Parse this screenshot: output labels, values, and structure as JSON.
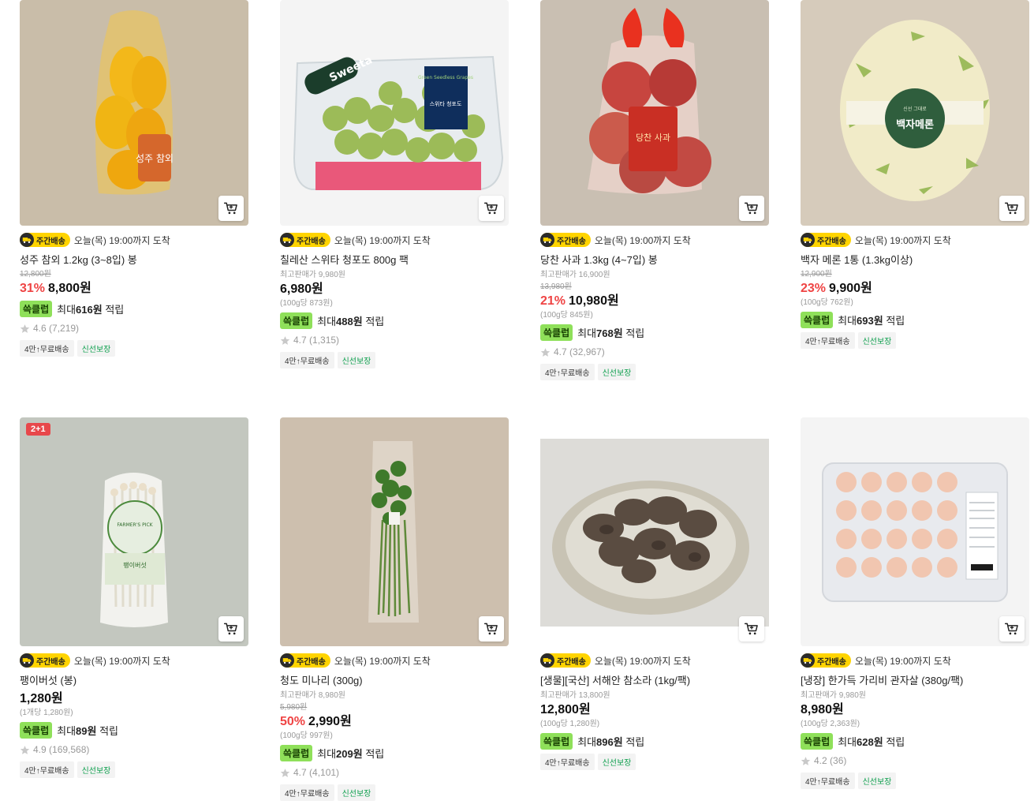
{
  "products": [
    {
      "delivery_badge": "주간배송",
      "delivery_text": "오늘(목) 19:00까지 도착",
      "name": "성주 참외 1.2kg (3~8입) 봉",
      "original_price": "12,800원",
      "discount": "31%",
      "price": "8,800원",
      "points_badge": "쓱클럽",
      "points_prefix": "최대",
      "points_amount": "616원",
      "points_suffix": "적립",
      "rating": "4.6",
      "reviews": "(7,219)",
      "tags": [
        "4만↑무료배송",
        "신선보장"
      ]
    },
    {
      "delivery_badge": "주간배송",
      "delivery_text": "오늘(목) 19:00까지 도착",
      "name": "칠레산 스위타 청포도 800g 팩",
      "highest_price": "최고판매가 9,980원",
      "price": "6,980원",
      "unit_price": "(100g당 873원)",
      "points_badge": "쓱클럽",
      "points_prefix": "최대",
      "points_amount": "488원",
      "points_suffix": "적립",
      "rating": "4.7",
      "reviews": "(1,315)",
      "tags": [
        "4만↑무료배송",
        "신선보장"
      ]
    },
    {
      "delivery_badge": "주간배송",
      "delivery_text": "오늘(목) 19:00까지 도착",
      "name": "당찬 사과 1.3kg (4~7입) 봉",
      "highest_price": "최고판매가 16,900원",
      "original_price": "13,980원",
      "discount": "21%",
      "price": "10,980원",
      "unit_price": "(100g당 845원)",
      "points_badge": "쓱클럽",
      "points_prefix": "최대",
      "points_amount": "768원",
      "points_suffix": "적립",
      "rating": "4.7",
      "reviews": "(32,967)",
      "tags": [
        "4만↑무료배송",
        "신선보장"
      ]
    },
    {
      "delivery_badge": "주간배송",
      "delivery_text": "오늘(목) 19:00까지 도착",
      "name": "백자 메론 1통 (1.3kg이상)",
      "original_price": "12,900원",
      "discount": "23%",
      "price": "9,900원",
      "unit_price": "(100g당 762원)",
      "points_badge": "쓱클럽",
      "points_prefix": "최대",
      "points_amount": "693원",
      "points_suffix": "적립",
      "tags": [
        "4만↑무료배송",
        "신선보장"
      ]
    },
    {
      "promo": "2+1",
      "delivery_badge": "주간배송",
      "delivery_text": "오늘(목) 19:00까지 도착",
      "name": "팽이버섯 (봉)",
      "price": "1,280원",
      "unit_price": "(1개당 1,280원)",
      "points_badge": "쓱클럽",
      "points_prefix": "최대",
      "points_amount": "89원",
      "points_suffix": "적립",
      "rating": "4.9",
      "reviews": "(169,568)",
      "tags": [
        "4만↑무료배송",
        "신선보장"
      ]
    },
    {
      "delivery_badge": "주간배송",
      "delivery_text": "오늘(목) 19:00까지 도착",
      "name": "청도 미나리 (300g)",
      "highest_price": "최고판매가 8,980원",
      "original_price": "5,980원",
      "discount": "50%",
      "price": "2,990원",
      "unit_price": "(100g당 997원)",
      "points_badge": "쓱클럽",
      "points_prefix": "최대",
      "points_amount": "209원",
      "points_suffix": "적립",
      "rating": "4.7",
      "reviews": "(4,101)",
      "tags": [
        "4만↑무료배송",
        "신선보장"
      ]
    },
    {
      "delivery_badge": "주간배송",
      "delivery_text": "오늘(목) 19:00까지 도착",
      "name": "[생물][국산] 서해안 참소라 (1kg/팩)",
      "highest_price": "최고판매가 13,800원",
      "price": "12,800원",
      "unit_price": "(100g당 1,280원)",
      "points_badge": "쓱클럽",
      "points_prefix": "최대",
      "points_amount": "896원",
      "points_suffix": "적립",
      "tags": [
        "4만↑무료배송",
        "신선보장"
      ]
    },
    {
      "delivery_badge": "주간배송",
      "delivery_text": "오늘(목) 19:00까지 도착",
      "name": "[냉장] 한가득 가리비 관자살 (380g/팩)",
      "highest_price": "최고판매가 9,980원",
      "price": "8,980원",
      "unit_price": "(100g당 2,363원)",
      "points_badge": "쓱클럽",
      "points_prefix": "최대",
      "points_amount": "628원",
      "points_suffix": "적립",
      "rating": "4.2",
      "reviews": "(36)",
      "tags": [
        "4만↑무료배송",
        "신선보장"
      ]
    }
  ],
  "image_labels": {
    "melon_bag_label": "성주 참외",
    "grape_brand": "Sweeta",
    "grape_tag": "Green Seedless Grapes",
    "grape_tag_kr": "스위타 청포도",
    "apple_label": "당찬 사과",
    "melon_sticker_small": "신선 그대로",
    "melon_sticker": "백자메론",
    "enoki_brand": "FARMER'S PICK",
    "enoki_label": "팽이버섯"
  },
  "colors": {
    "discount": "#ef4444",
    "points_badge": "#8fe05a",
    "delivery_badge": "#ffd400",
    "fresh_tag": "#0d9f4d",
    "promo_badge": "#e8484b"
  }
}
